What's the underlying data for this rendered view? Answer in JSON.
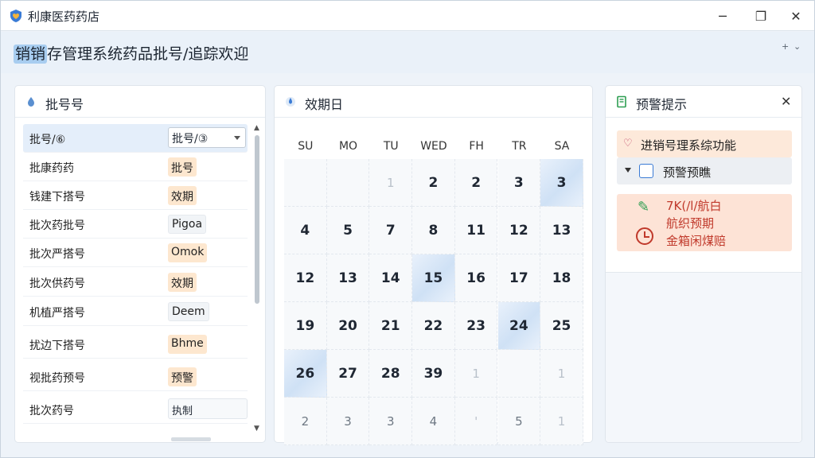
{
  "window": {
    "title": "利康医药药店",
    "controls": {
      "minimize": "─",
      "maximize": "❐",
      "close": "✕"
    }
  },
  "header": {
    "title_highlight": "销销",
    "title_rest": "存管理系统药品批号/追踪欢迎",
    "plus": "+",
    "chevron": "⌄"
  },
  "left_panel": {
    "title": "批号号",
    "rows": [
      {
        "label": "批号/⑥",
        "value": "批号/③",
        "kind": "select"
      },
      {
        "label": "批康药药",
        "value": "批号",
        "kind": "orange"
      },
      {
        "label": "钱建下搭号",
        "value": "效期",
        "kind": "orange"
      },
      {
        "label": "批次药批号",
        "value": "Pigoa",
        "kind": "plain"
      },
      {
        "label": "批次严搭号",
        "value": "Omok",
        "kind": "orange"
      },
      {
        "label": "批次供药号",
        "value": "效期",
        "kind": "orange"
      },
      {
        "label": "机植严搭号",
        "value": "Deem",
        "kind": "plain"
      },
      {
        "label": "扰边下搭号",
        "value": "Bhme",
        "kind": "orange"
      },
      {
        "label": "视批药预号",
        "value": "预警",
        "kind": "orange"
      },
      {
        "label": "批次药号",
        "value": "执制",
        "kind": "wide"
      }
    ]
  },
  "calendar_panel": {
    "title": "效期日",
    "weekdays": [
      "SU",
      "MO",
      "TU",
      "WED",
      "FH",
      "TR",
      "SA"
    ],
    "weeks": [
      [
        {
          "d": "",
          "s": ""
        },
        {
          "d": "",
          "s": ""
        },
        {
          "d": "1",
          "s": "faint"
        },
        {
          "d": "2",
          "s": ""
        },
        {
          "d": "2",
          "s": ""
        },
        {
          "d": "3",
          "s": ""
        },
        {
          "d": "3",
          "s": "hl"
        }
      ],
      [
        {
          "d": "4",
          "s": ""
        },
        {
          "d": "5",
          "s": ""
        },
        {
          "d": "7",
          "s": ""
        },
        {
          "d": "8",
          "s": ""
        },
        {
          "d": "11",
          "s": ""
        },
        {
          "d": "12",
          "s": ""
        },
        {
          "d": "13",
          "s": ""
        }
      ],
      [
        {
          "d": "12",
          "s": ""
        },
        {
          "d": "13",
          "s": ""
        },
        {
          "d": "14",
          "s": ""
        },
        {
          "d": "15",
          "s": "hl"
        },
        {
          "d": "16",
          "s": ""
        },
        {
          "d": "17",
          "s": ""
        },
        {
          "d": "18",
          "s": ""
        }
      ],
      [
        {
          "d": "19",
          "s": ""
        },
        {
          "d": "20",
          "s": ""
        },
        {
          "d": "21",
          "s": ""
        },
        {
          "d": "22",
          "s": ""
        },
        {
          "d": "23",
          "s": ""
        },
        {
          "d": "24",
          "s": "hl"
        },
        {
          "d": "25",
          "s": ""
        }
      ],
      [
        {
          "d": "26",
          "s": "hl"
        },
        {
          "d": "27",
          "s": ""
        },
        {
          "d": "28",
          "s": ""
        },
        {
          "d": "39",
          "s": ""
        },
        {
          "d": "1",
          "s": "faint"
        },
        {
          "d": "",
          "s": ""
        },
        {
          "d": "1",
          "s": "faint"
        }
      ],
      [
        {
          "d": "2",
          "s": "muted"
        },
        {
          "d": "3",
          "s": "muted"
        },
        {
          "d": "3",
          "s": "muted"
        },
        {
          "d": "4",
          "s": "muted"
        },
        {
          "d": "'",
          "s": "faint"
        },
        {
          "d": "5",
          "s": "muted"
        },
        {
          "d": "1",
          "s": "faint"
        }
      ]
    ]
  },
  "alert_panel": {
    "title": "预警提示",
    "close": "✕",
    "feature_item": "进销号理系综功能",
    "expand_item": "预警预瞧",
    "alert_lines": [
      "7K(/l/航白",
      "航织预期",
      "金箱闲煤赔"
    ]
  },
  "colors": {
    "accent": "#3a7bd5",
    "title_highlight": "#a8cdf0",
    "tag_orange": "#fde7cf",
    "alert_red": "#c0392b",
    "selection": "#e4eefa"
  }
}
